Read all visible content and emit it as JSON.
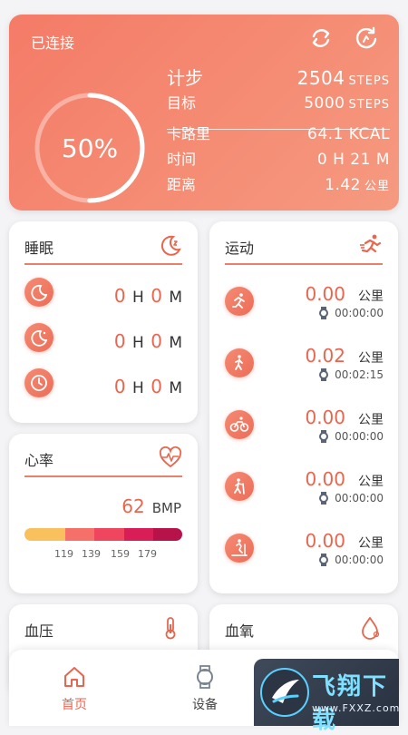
{
  "top": {
    "status": "已连接",
    "ring_percent": "50%",
    "ring_fraction": 0.5,
    "steps": {
      "label": "计步",
      "value": "2504",
      "unit": "STEPS"
    },
    "goal": {
      "label": "目标",
      "value": "5000",
      "unit": "STEPS"
    },
    "calories": {
      "label": "卡路里",
      "value": "64.1 KCAL"
    },
    "time": {
      "label": "时间",
      "value": "0 H 21 M"
    },
    "distance": {
      "label": "距离",
      "value": "1.42",
      "unit": "公里"
    }
  },
  "sleep": {
    "title": "睡眠",
    "rows": [
      {
        "icon": "moon-icon",
        "h": "0",
        "h_unit": "H",
        "m": "0",
        "m_unit": "M"
      },
      {
        "icon": "moon-star-icon",
        "h": "0",
        "h_unit": "H",
        "m": "0",
        "m_unit": "M"
      },
      {
        "icon": "clock-icon",
        "h": "0",
        "h_unit": "H",
        "m": "0",
        "m_unit": "M"
      }
    ]
  },
  "sport": {
    "title": "运动",
    "rows": [
      {
        "icon": "run-icon",
        "distance": "0.00",
        "unit": "公里",
        "time": "00:00:00"
      },
      {
        "icon": "walk-icon",
        "distance": "0.02",
        "unit": "公里",
        "time": "00:02:15"
      },
      {
        "icon": "bike-icon",
        "distance": "0.00",
        "unit": "公里",
        "time": "00:00:00"
      },
      {
        "icon": "hike-icon",
        "distance": "0.00",
        "unit": "公里",
        "time": "00:00:00"
      },
      {
        "icon": "treadmill-icon",
        "distance": "0.00",
        "unit": "公里",
        "time": "00:00:00"
      }
    ]
  },
  "heart": {
    "title": "心率",
    "value": "62",
    "unit": "BMP",
    "ticks": [
      "119",
      "139",
      "159",
      "179"
    ],
    "zone_colors": [
      "#f9c15e",
      "#f6706a",
      "#f0455f",
      "#d91d57",
      "#b8124a"
    ]
  },
  "bp": {
    "title": "血压"
  },
  "oxygen": {
    "title": "血氧"
  },
  "nav": {
    "home": "首页",
    "device": "设备"
  },
  "watermark": {
    "text": "飞翔下载",
    "url": "www.FXXZ.com"
  },
  "colors": {
    "accent": "#e8664f",
    "card_top": "#f47b67"
  }
}
